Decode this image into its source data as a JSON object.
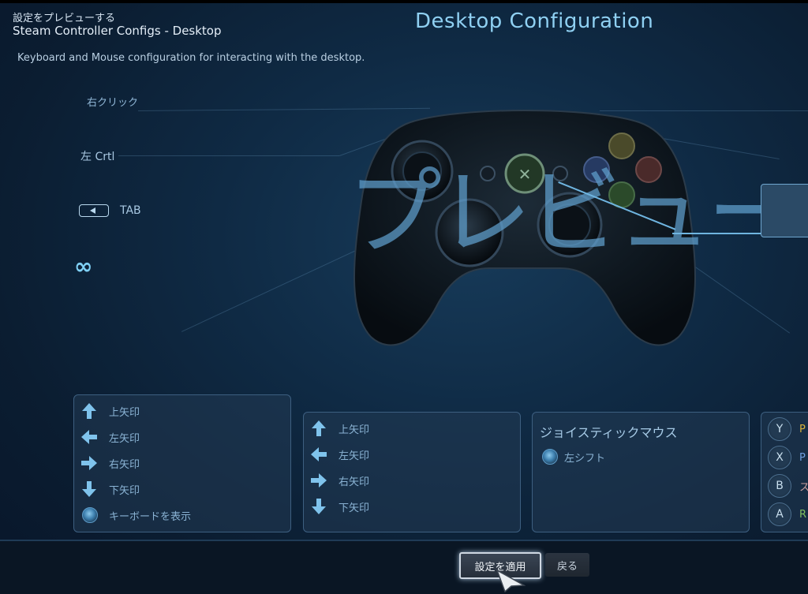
{
  "header": {
    "subtitle": "設定をプレビューする",
    "title": "Steam Controller Configs - Desktop"
  },
  "main_title": "Desktop Configuration",
  "description": "Keyboard and Mouse configuration for interacting with the desktop.",
  "left_labels": {
    "right_click": "右クリック",
    "left_ctrl": "左 Crtl",
    "tab": "TAB",
    "infinity_icon": "∞"
  },
  "preview_watermark": "プレビュー",
  "panels": {
    "left_dpad": {
      "items": [
        "上矢印",
        "左矢印",
        "右矢印",
        "下矢印",
        "キーボードを表示"
      ],
      "icons": [
        "arrow-up-icon",
        "arrow-left-icon",
        "arrow-right-icon",
        "arrow-down-icon",
        "joystick-click-icon"
      ]
    },
    "right_dpad": {
      "items": [
        "上矢印",
        "左矢印",
        "右矢印",
        "下矢印"
      ],
      "icons": [
        "arrow-up-icon",
        "arrow-left-icon",
        "arrow-right-icon",
        "arrow-down-icon"
      ]
    },
    "joystick": {
      "title": "ジョイスティックマウス",
      "click_label": "左シフト"
    },
    "face_buttons": {
      "buttons": [
        "Y",
        "X",
        "B",
        "A"
      ],
      "partial_labels": [
        "P",
        "P",
        "ス",
        "R"
      ]
    }
  },
  "buttons": {
    "apply": "設定を適用",
    "back": "戻る"
  },
  "colors": {
    "accent": "#8fd0f2",
    "arrow_icon": "#7fc3ec",
    "face_Y": "#d8b23a",
    "face_X": "#3a73c7",
    "face_B": "#c43c3c",
    "face_A": "#5fb33e"
  }
}
